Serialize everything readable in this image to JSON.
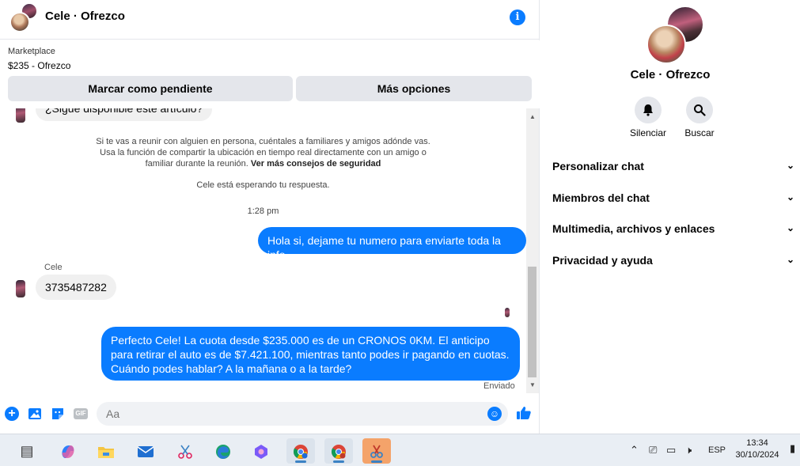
{
  "header": {
    "title": "Cele · Ofrezco"
  },
  "marketplace": {
    "label": "Marketplace",
    "price_line": "$235 - Ofrezco",
    "pending_button": "Marcar como pendiente",
    "more_button": "Más opciones"
  },
  "messages": {
    "first_in": "¿Sigue disponible este artículo?",
    "safety_text": "Si te vas a reunir con alguien en persona, cuéntales a familiares y amigos adónde vas. Usa la función de compartir la ubicación en tiempo real directamente con un amigo o familiar durante la reunión.",
    "safety_link": "Ver más consejos de seguridad",
    "waiting": "Cele está esperando tu respuesta.",
    "time": "1:28 pm",
    "out_1": "Hola si, dejame tu numero para enviarte toda la info",
    "sender_name": "Cele",
    "in_number": "3735487282",
    "out_2": "Perfecto Cele! La cuota desde $235.000 es de un CRONOS 0KM. El anticipo para retirar el auto es de $7.421.100, mientras tanto podes ir pagando en cuotas. Cuándo podes hablar? A la mañana o a la tarde?",
    "status": "Enviado"
  },
  "composer": {
    "placeholder": "Aa",
    "gif": "GIF"
  },
  "info_panel": {
    "name": "Cele · Ofrezco",
    "actions": [
      {
        "label": "Silenciar",
        "icon": "bell-icon"
      },
      {
        "label": "Buscar",
        "icon": "search-icon"
      }
    ],
    "sections": [
      "Personalizar chat",
      "Miembros del chat",
      "Multimedia, archivos y enlaces",
      "Privacidad y ayuda"
    ]
  },
  "taskbar": {
    "apps": [
      "task-view",
      "copilot",
      "file-explorer",
      "mail",
      "snipping-tool",
      "edge",
      "teams",
      "chrome",
      "chrome-profile",
      "app-orange"
    ],
    "language": "ESP",
    "time": "13:34",
    "date": "30/10/2024"
  },
  "colors": {
    "accent": "#0a7cff",
    "bubble_in": "#f0f0f0",
    "button_gray": "#e4e6eb"
  }
}
